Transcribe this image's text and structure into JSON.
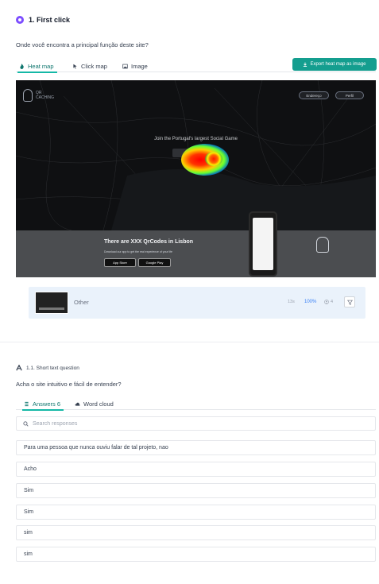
{
  "q1": {
    "title": "1. First click",
    "question": "Onde você encontra a principal função deste site?",
    "tabs": [
      {
        "label": "Heat map",
        "icon": "flame-icon",
        "active": true
      },
      {
        "label": "Click map",
        "icon": "pointer-icon",
        "active": false
      },
      {
        "label": "Image",
        "icon": "image-icon",
        "active": false
      }
    ],
    "export_label": "Export heat map as image",
    "heatmap": {
      "logo_text": "QR CACHING",
      "nav_buttons": [
        "Endereço",
        "Perfil"
      ],
      "headline": "Join the Portugal's largest Social Game",
      "footer_title": "There are XXX QrCodes in Lisbon",
      "footer_sub": "Download our app to get the real experience of your life",
      "store_buttons": [
        "App Store",
        "Google Play"
      ]
    },
    "result_row": {
      "label": "Other",
      "time": "13s",
      "percent": "100%",
      "count": "4"
    }
  },
  "q2": {
    "type_label": "1.1. Short text question",
    "question": "Acha o site intuitivo e fácil de entender?",
    "tabs": [
      {
        "label": "Answers 6",
        "icon": "list-icon",
        "active": true
      },
      {
        "label": "Word cloud",
        "icon": "cloud-icon",
        "active": false
      }
    ],
    "search_placeholder": "Search responses",
    "responses": [
      "Para uma pessoa que nunca ouviu falar de tal projeto, nao",
      "Acho",
      "Sim",
      "Sim",
      "sim",
      "sim"
    ]
  },
  "colors": {
    "accent": "#149e8f",
    "badge": "#7c4dff",
    "link_blue": "#3b82f6"
  }
}
